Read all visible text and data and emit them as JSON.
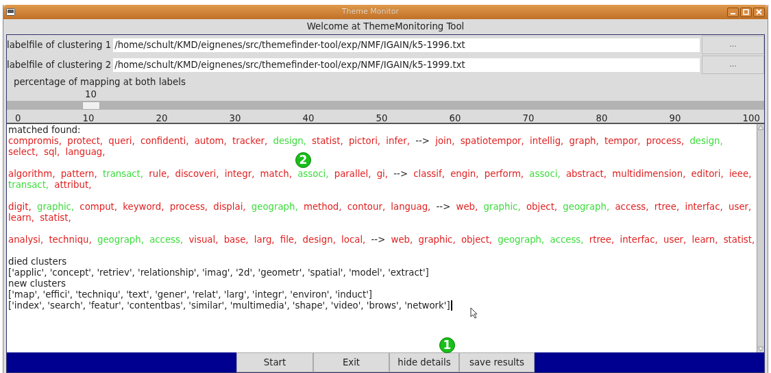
{
  "window": {
    "title": "Theme Monitor"
  },
  "header": "Welcome at ThemeMonitoring Tool",
  "files": [
    {
      "label": "labelfile of clustering 1",
      "value": "/home/schult/KMD/eignenes/src/themefinder-tool/exp/NMF/IGAIN/k5-1996.txt",
      "button": "..."
    },
    {
      "label": "labelfile of clustering 2",
      "value": "/home/schult/KMD/eignenes/src/themefinder-tool/exp/NMF/IGAIN/k5-1999.txt",
      "button": "..."
    }
  ],
  "slider": {
    "label": "percentage of mapping at both labels",
    "reading": "10",
    "level": 0.1,
    "ticks": [
      "0",
      "10",
      "20",
      "30",
      "40",
      "50",
      "60",
      "70",
      "80",
      "90",
      "100"
    ]
  },
  "output": {
    "heading": "matched found:",
    "arrow": "-->",
    "matches": [
      {
        "left": [
          {
            "text": "compromis,",
            "shared": false
          },
          {
            "text": "protect,",
            "shared": false
          },
          {
            "text": "queri,",
            "shared": false
          },
          {
            "text": "confidenti,",
            "shared": false
          },
          {
            "text": "autom,",
            "shared": false
          },
          {
            "text": "tracker,",
            "shared": false
          },
          {
            "text": "design,",
            "shared": true
          },
          {
            "text": "statist,",
            "shared": false
          },
          {
            "text": "pictori,",
            "shared": false
          },
          {
            "text": "infer,",
            "shared": false
          }
        ],
        "right": [
          {
            "text": "join,",
            "shared": false
          },
          {
            "text": "spatiotempor,",
            "shared": false
          },
          {
            "text": "intellig,",
            "shared": false
          },
          {
            "text": "graph,",
            "shared": false
          },
          {
            "text": "tempor,",
            "shared": false
          },
          {
            "text": "process,",
            "shared": false
          },
          {
            "text": "design,",
            "shared": true
          },
          {
            "text": "select,",
            "shared": false
          },
          {
            "text": "sql,",
            "shared": false
          },
          {
            "text": "languag,",
            "shared": false
          }
        ]
      },
      {
        "left": [
          {
            "text": "algorithm,",
            "shared": false
          },
          {
            "text": "pattern,",
            "shared": false
          },
          {
            "text": "transact,",
            "shared": true
          },
          {
            "text": "rule,",
            "shared": false
          },
          {
            "text": "discoveri,",
            "shared": false
          },
          {
            "text": "integr,",
            "shared": false
          },
          {
            "text": "match,",
            "shared": false
          },
          {
            "text": "associ,",
            "shared": true
          },
          {
            "text": "parallel,",
            "shared": false
          },
          {
            "text": "gi,",
            "shared": false
          }
        ],
        "right": [
          {
            "text": "classif,",
            "shared": false
          },
          {
            "text": "engin,",
            "shared": false
          },
          {
            "text": "perform,",
            "shared": false
          },
          {
            "text": "associ,",
            "shared": true
          },
          {
            "text": "abstract,",
            "shared": false
          },
          {
            "text": "multidimension,",
            "shared": false
          },
          {
            "text": "editori,",
            "shared": false
          },
          {
            "text": "ieee,",
            "shared": false
          },
          {
            "text": "transact,",
            "shared": true
          },
          {
            "text": "attribut,",
            "shared": false
          }
        ]
      },
      {
        "left": [
          {
            "text": "digit,",
            "shared": false
          },
          {
            "text": "graphic,",
            "shared": true
          },
          {
            "text": "comput,",
            "shared": false
          },
          {
            "text": "keyword,",
            "shared": false
          },
          {
            "text": "process,",
            "shared": false
          },
          {
            "text": "displai,",
            "shared": false
          },
          {
            "text": "geograph,",
            "shared": true
          },
          {
            "text": "method,",
            "shared": false
          },
          {
            "text": "contour,",
            "shared": false
          },
          {
            "text": "languag,",
            "shared": false
          }
        ],
        "right": [
          {
            "text": "web,",
            "shared": false
          },
          {
            "text": "graphic,",
            "shared": true
          },
          {
            "text": "object,",
            "shared": false
          },
          {
            "text": "geograph,",
            "shared": true
          },
          {
            "text": "access,",
            "shared": false
          },
          {
            "text": "rtree,",
            "shared": false
          },
          {
            "text": "interfac,",
            "shared": false
          },
          {
            "text": "user,",
            "shared": false
          },
          {
            "text": "learn,",
            "shared": false
          },
          {
            "text": "statist,",
            "shared": false
          }
        ]
      },
      {
        "left": [
          {
            "text": "analysi,",
            "shared": false
          },
          {
            "text": "techniqu,",
            "shared": false
          },
          {
            "text": "geograph,",
            "shared": true
          },
          {
            "text": "access,",
            "shared": true
          },
          {
            "text": "visual,",
            "shared": false
          },
          {
            "text": "base,",
            "shared": false
          },
          {
            "text": "larg,",
            "shared": false
          },
          {
            "text": "file,",
            "shared": false
          },
          {
            "text": "design,",
            "shared": false
          },
          {
            "text": "local,",
            "shared": false
          }
        ],
        "right": [
          {
            "text": "web,",
            "shared": false
          },
          {
            "text": "graphic,",
            "shared": false
          },
          {
            "text": "object,",
            "shared": false
          },
          {
            "text": "geograph,",
            "shared": true
          },
          {
            "text": "access,",
            "shared": true
          },
          {
            "text": "rtree,",
            "shared": false
          },
          {
            "text": "interfac,",
            "shared": false
          },
          {
            "text": "user,",
            "shared": false
          },
          {
            "text": "learn,",
            "shared": false
          },
          {
            "text": "statist,",
            "shared": false
          }
        ]
      }
    ],
    "lines": [
      "died clusters",
      "['applic', 'concept', 'retriev', 'relationship', 'imag', '2d', 'geometr', 'spatial', 'model', 'extract']",
      "new clusters",
      "['map', 'effici', 'techniqu', 'text', 'gener', 'relat', 'larg', 'integr', 'environ', 'induct']",
      "['index', 'search', 'featur', 'contentbas', 'similar', 'multimedia', 'shape', 'video', 'brows', 'network']"
    ]
  },
  "buttons": [
    "Start",
    "Exit",
    "hide details",
    "save results"
  ],
  "markers": [
    {
      "text": "1"
    },
    {
      "text": "2"
    }
  ]
}
